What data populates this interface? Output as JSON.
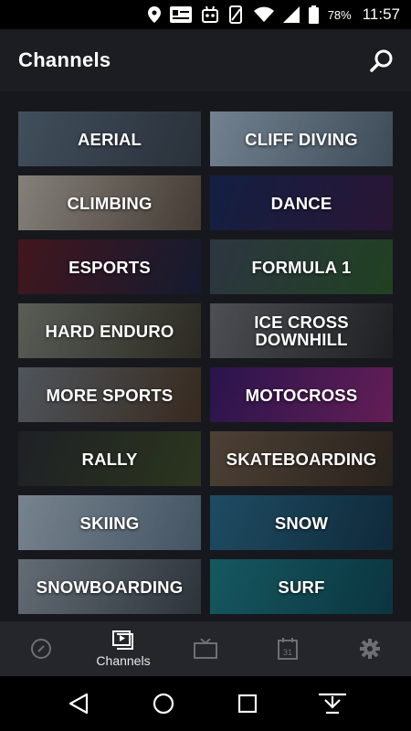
{
  "status_bar": {
    "battery": "78%",
    "time": "11:57"
  },
  "app_bar": {
    "title": "Channels"
  },
  "channels": [
    {
      "label": "AERIAL",
      "colors": [
        "#5a6e80",
        "#3a4450"
      ]
    },
    {
      "label": "CLIFF DIVING",
      "colors": [
        "#9fb4c8",
        "#56697a"
      ]
    },
    {
      "label": "CLIMBING",
      "colors": [
        "#b8b2a8",
        "#5e5349"
      ]
    },
    {
      "label": "DANCE",
      "colors": [
        "#1b2c5c",
        "#3a1e4a"
      ]
    },
    {
      "label": "ESPORTS",
      "colors": [
        "#5b1f2a",
        "#1d2542"
      ]
    },
    {
      "label": "FORMULA 1",
      "colors": [
        "#3e4a5a",
        "#2d5a2e"
      ]
    },
    {
      "label": "HARD ENDURO",
      "colors": [
        "#7b8278",
        "#3d3a30"
      ]
    },
    {
      "label": "ICE CROSS DOWNHILL",
      "colors": [
        "#6a6e74",
        "#2a2c30"
      ]
    },
    {
      "label": "MORE SPORTS",
      "colors": [
        "#6d7680",
        "#4d3a2a"
      ]
    },
    {
      "label": "MOTOCROSS",
      "colors": [
        "#3a1c6a",
        "#8a2a78"
      ]
    },
    {
      "label": "RALLY",
      "colors": [
        "#2a2e33",
        "#3c4a2a"
      ]
    },
    {
      "label": "SKATEBOARDING",
      "colors": [
        "#6b5a4a",
        "#3a3028"
      ]
    },
    {
      "label": "SKIING",
      "colors": [
        "#a5b7c6",
        "#5e7488"
      ]
    },
    {
      "label": "SNOW",
      "colors": [
        "#2b6a8a",
        "#153a50"
      ]
    },
    {
      "label": "SNOWBOARDING",
      "colors": [
        "#8a96a2",
        "#3e4852"
      ]
    },
    {
      "label": "SURF",
      "colors": [
        "#1f7a86",
        "#0f4a58"
      ]
    }
  ],
  "bottom_nav": {
    "items": [
      {
        "label": "",
        "icon": "compass-icon"
      },
      {
        "label": "Channels",
        "icon": "channels-icon"
      },
      {
        "label": "",
        "icon": "tv-icon"
      },
      {
        "label": "",
        "icon": "calendar-icon",
        "badge": "31"
      },
      {
        "label": "",
        "icon": "gear-icon"
      }
    ],
    "active_index": 1
  },
  "system_nav": {
    "items": [
      "back-icon",
      "home-icon",
      "recents-icon",
      "notifications-icon"
    ]
  }
}
